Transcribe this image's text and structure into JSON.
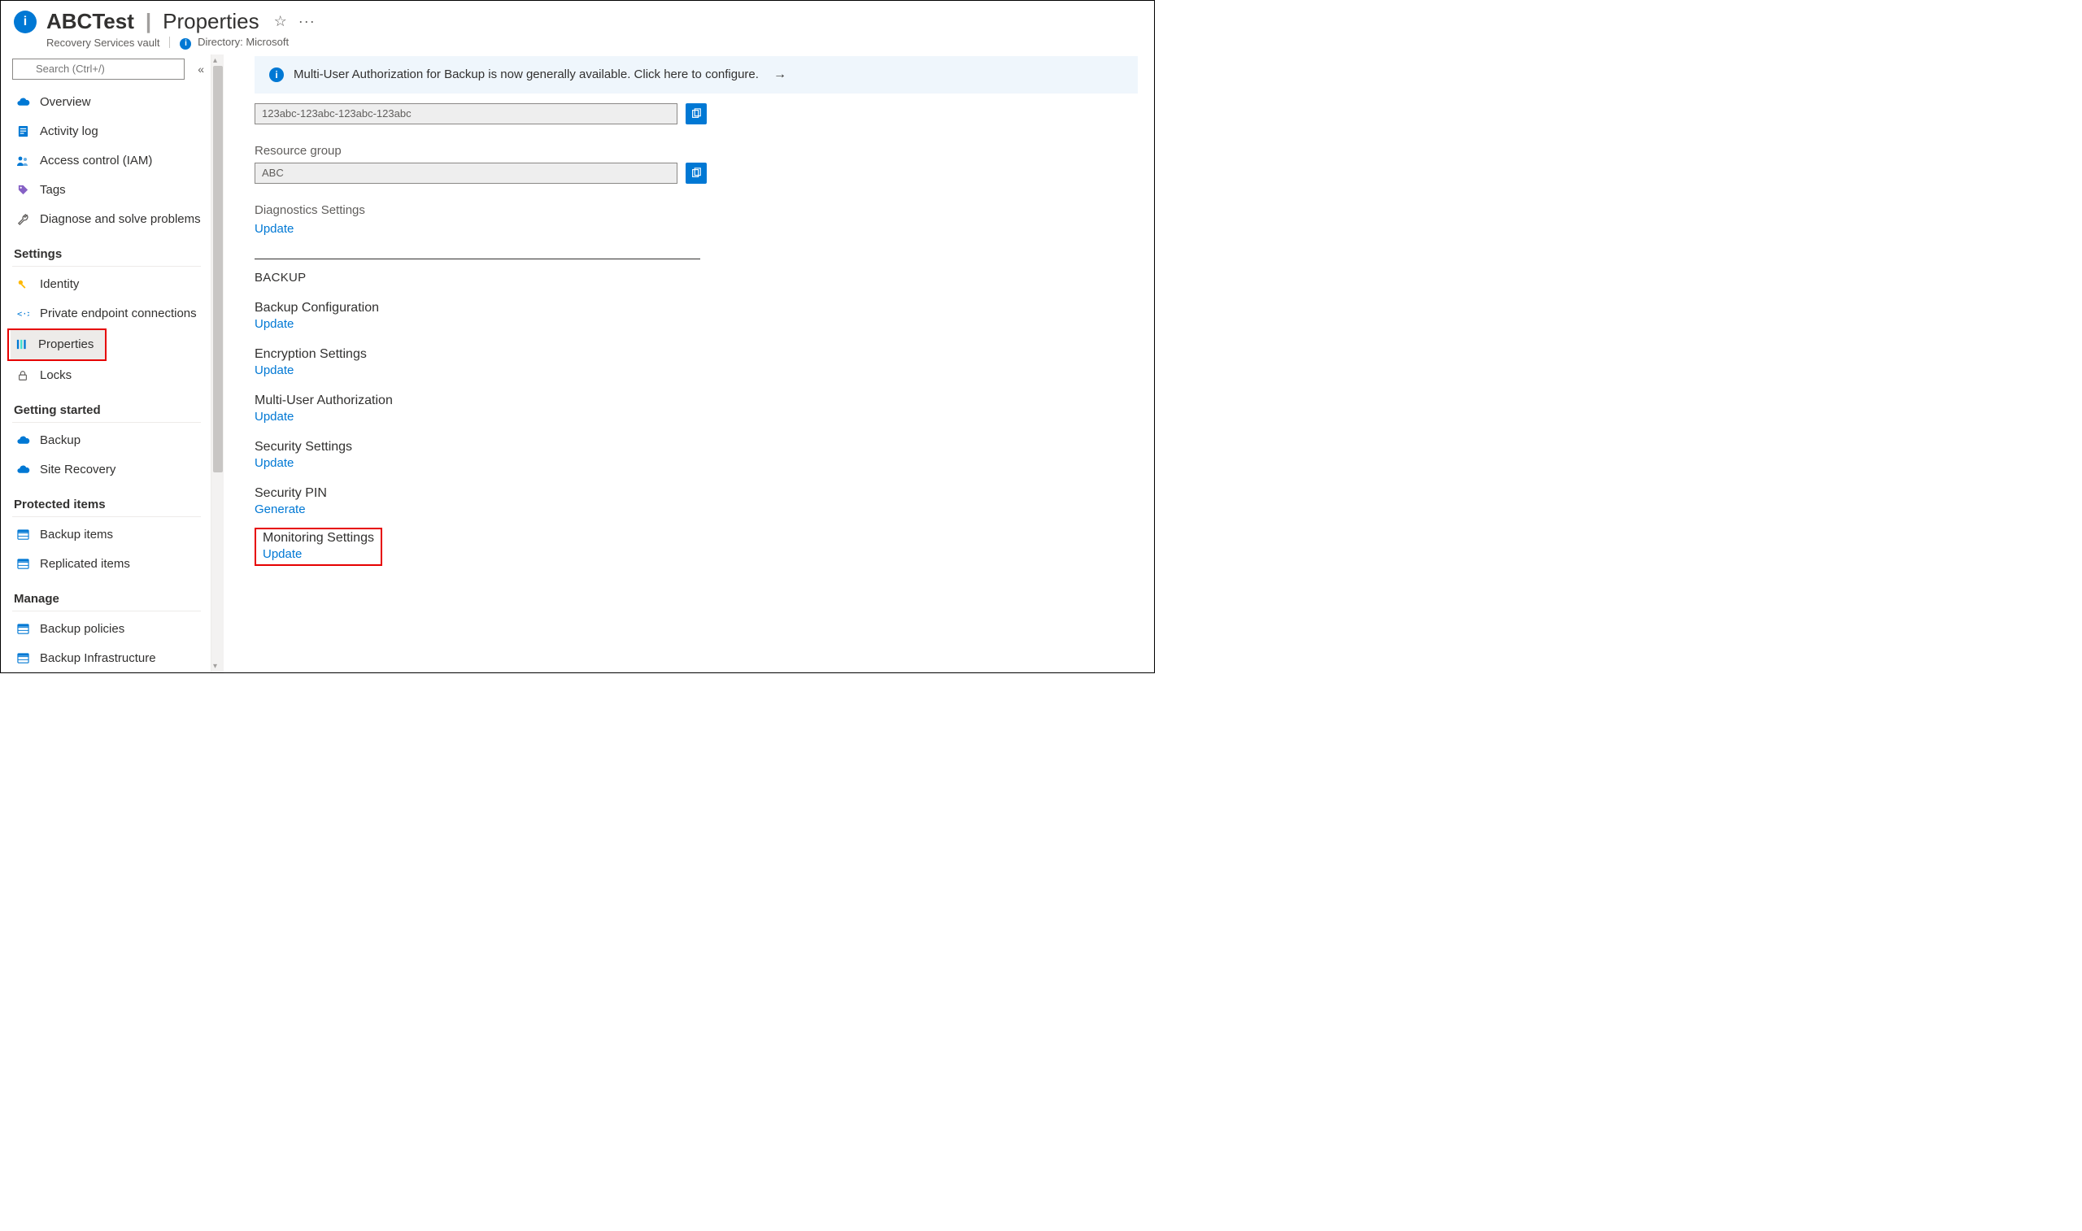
{
  "header": {
    "resource_name": "ABCTest",
    "separator": "|",
    "page_title": "Properties",
    "resource_type": "Recovery Services vault",
    "directory_label": "Directory:",
    "directory_value": "Microsoft"
  },
  "sidebar": {
    "search_placeholder": "Search (Ctrl+/)",
    "top_items": [
      {
        "label": "Overview",
        "icon": "cloud"
      },
      {
        "label": "Activity log",
        "icon": "log"
      },
      {
        "label": "Access control (IAM)",
        "icon": "people"
      },
      {
        "label": "Tags",
        "icon": "tag"
      },
      {
        "label": "Diagnose and solve problems",
        "icon": "wrench"
      }
    ],
    "sections": [
      {
        "heading": "Settings",
        "items": [
          {
            "label": "Identity",
            "icon": "key"
          },
          {
            "label": "Private endpoint connections",
            "icon": "endpoint"
          },
          {
            "label": "Properties",
            "icon": "sliders",
            "selected": true,
            "highlight": true
          },
          {
            "label": "Locks",
            "icon": "lock"
          }
        ]
      },
      {
        "heading": "Getting started",
        "items": [
          {
            "label": "Backup",
            "icon": "cloud"
          },
          {
            "label": "Site Recovery",
            "icon": "cloud"
          }
        ]
      },
      {
        "heading": "Protected items",
        "items": [
          {
            "label": "Backup items",
            "icon": "grid"
          },
          {
            "label": "Replicated items",
            "icon": "grid"
          }
        ]
      },
      {
        "heading": "Manage",
        "items": [
          {
            "label": "Backup policies",
            "icon": "grid"
          },
          {
            "label": "Backup Infrastructure",
            "icon": "grid"
          }
        ]
      }
    ]
  },
  "main": {
    "banner_text": "Multi-User Authorization for Backup is now generally available. Click here to configure.",
    "subscription_id": "123abc-123abc-123abc-123abc",
    "resource_group_label": "Resource group",
    "resource_group_value": "ABC",
    "diagnostics_label": "Diagnostics Settings",
    "diagnostics_link": "Update",
    "backup_heading": "BACKUP",
    "settings": [
      {
        "title": "Backup Configuration",
        "link": "Update"
      },
      {
        "title": "Encryption Settings",
        "link": "Update"
      },
      {
        "title": "Multi-User Authorization",
        "link": "Update"
      },
      {
        "title": "Security Settings",
        "link": "Update"
      },
      {
        "title": "Security PIN",
        "link": "Generate"
      }
    ],
    "monitoring": {
      "title": "Monitoring Settings",
      "link": "Update"
    }
  }
}
